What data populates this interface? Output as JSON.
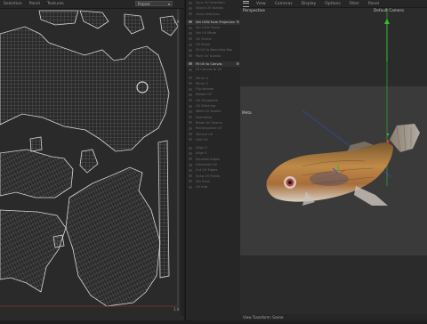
{
  "uv_editor": {
    "menu": [
      "Selection",
      "Panel",
      "Textures"
    ],
    "selector_value": "Project",
    "corner_number": "1.0",
    "corner_number_bottom": "1.0"
  },
  "uv_tools": [
    {
      "label": "Sync UV Selection",
      "active": false
    },
    {
      "label": "Select UV Islands",
      "active": false
    },
    {
      "label": "Grow Selection",
      "active": false
    },
    {
      "label": "Set UVW from Projection",
      "active": true,
      "gear": true
    },
    {
      "label": "Set UVW Fence",
      "active": false
    },
    {
      "label": "Set UV Mode",
      "active": false
    },
    {
      "label": "UV Shrink",
      "active": false
    },
    {
      "label": "UV Relax",
      "active": false
    },
    {
      "label": "Fit UV to Bounding Box",
      "active": false
    },
    {
      "label": "Pack UV Islands",
      "active": false
    },
    {
      "label": "Fit UV to Canvas",
      "active": true,
      "gear": true
    },
    {
      "label": "Fit Canvas to UV",
      "active": false
    },
    {
      "label": "Mirror U",
      "active": false
    },
    {
      "label": "Mirror V",
      "active": false
    },
    {
      "label": "Flip Islands",
      "active": false
    },
    {
      "label": "Rotate UV",
      "active": false
    },
    {
      "label": "UV Straighten",
      "active": false
    },
    {
      "label": "UV Stitching",
      "active": false
    },
    {
      "label": "Weld UV Seams",
      "active": false
    },
    {
      "label": "Normalize",
      "active": false
    },
    {
      "label": "Break UV Seams",
      "active": false
    },
    {
      "label": "Rectangulize UV",
      "active": false
    },
    {
      "label": "Terrace UV",
      "active": false
    },
    {
      "label": "Grid UV",
      "active": false
    },
    {
      "label": "Align U",
      "active": false
    },
    {
      "label": "Align V",
      "active": false
    },
    {
      "label": "Equalize Edges",
      "active": false
    },
    {
      "label": "Distribute UV",
      "active": false
    },
    {
      "label": "Cut UV Edges",
      "active": false
    },
    {
      "label": "Snap UV Points",
      "active": false
    },
    {
      "label": "Set Pivot",
      "active": false
    },
    {
      "label": "UV Info",
      "active": false
    }
  ],
  "viewport": {
    "menu": [
      "View",
      "Cameras",
      "Display",
      "Options",
      "Filter",
      "Panel"
    ],
    "view_name": "Perspective",
    "camera": "Default Camera",
    "axis_label": "Meta",
    "status": "View Transform: Scene"
  },
  "colors": {
    "uv_bg": "#2a2a2a",
    "uv_lines": "#cfcfcf",
    "fish_body": "#b07a3c",
    "axis_x": "#e04040",
    "axis_y": "#40c040",
    "axis_z": "#4060e0"
  }
}
